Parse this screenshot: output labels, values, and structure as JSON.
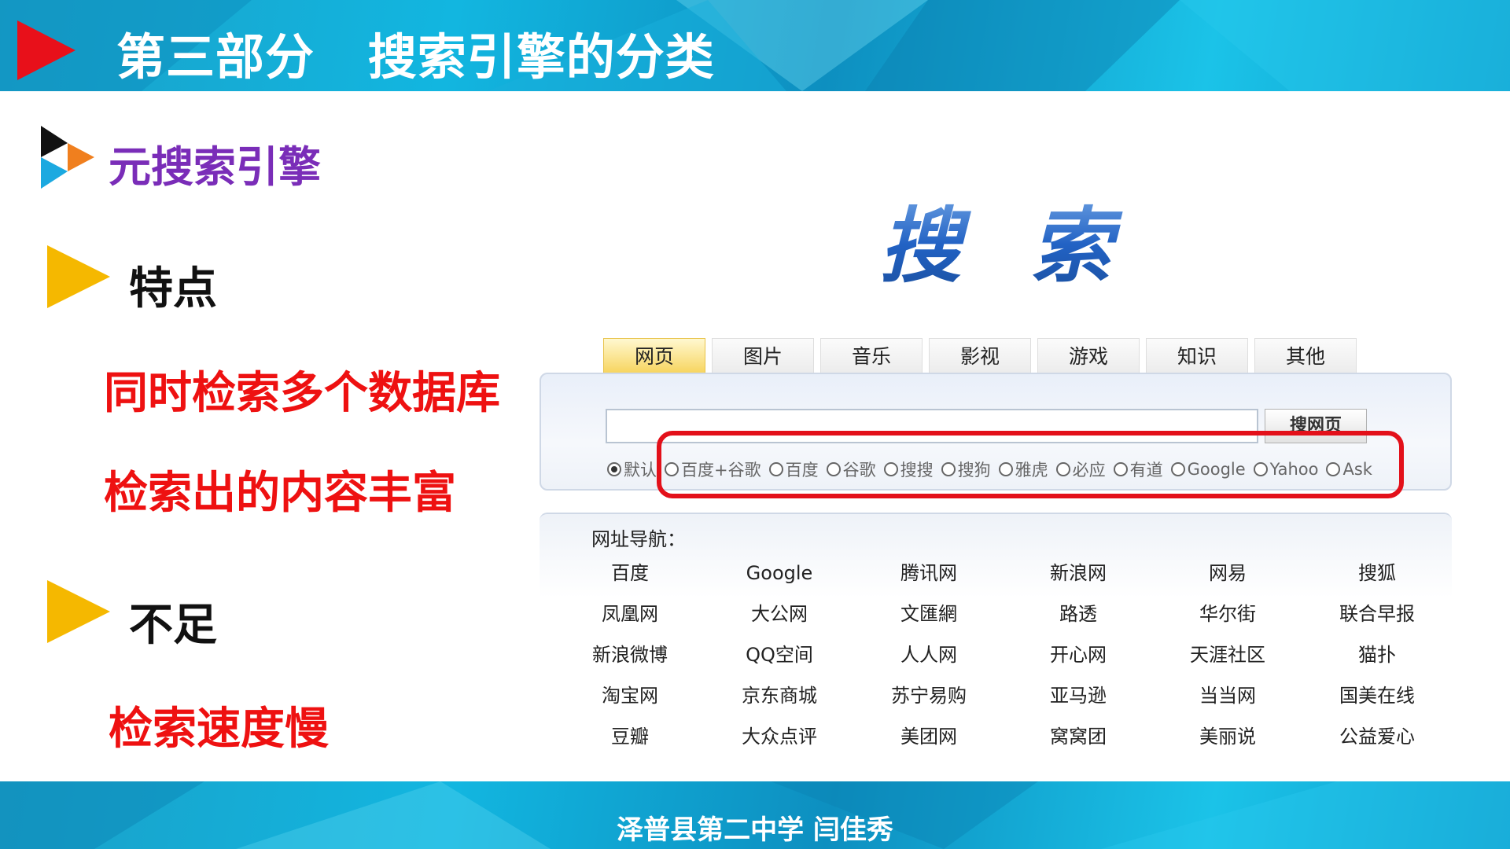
{
  "slide": {
    "title": "第三部分   搜索引擎的分类",
    "footer": "泽普县第二中学  闫佳秀"
  },
  "content": {
    "section_heading": "元搜索引擎",
    "features": {
      "heading": "特点",
      "points": [
        "同时检索多个数据库",
        "检索出的内容丰富"
      ]
    },
    "shortcomings": {
      "heading": "不足",
      "points": [
        "检索速度慢"
      ]
    }
  },
  "search_ui": {
    "logo_text": "搜索",
    "tabs": [
      "网页",
      "图片",
      "音乐",
      "影视",
      "游戏",
      "知识",
      "其他"
    ],
    "active_tab": "网页",
    "search_input_value": "",
    "search_button_label": "搜网页",
    "engines": [
      {
        "label": "默认",
        "checked": true
      },
      {
        "label": "百度+谷歌",
        "checked": false
      },
      {
        "label": "百度",
        "checked": false
      },
      {
        "label": "谷歌",
        "checked": false
      },
      {
        "label": "搜搜",
        "checked": false
      },
      {
        "label": "搜狗",
        "checked": false
      },
      {
        "label": "雅虎",
        "checked": false
      },
      {
        "label": "必应",
        "checked": false
      },
      {
        "label": "有道",
        "checked": false
      },
      {
        "label": "Google",
        "checked": false
      },
      {
        "label": "Yahoo",
        "checked": false
      },
      {
        "label": "Ask",
        "checked": false
      }
    ],
    "highlight_color": "#e3101a",
    "nav_label": "网址导航：",
    "nav_links": [
      "百度",
      "Google",
      "腾讯网",
      "新浪网",
      "网易",
      "搜狐",
      "凤凰网",
      "大公网",
      "文匯網",
      "路透",
      "华尔街",
      "联合早报",
      "新浪微博",
      "QQ空间",
      "人人网",
      "开心网",
      "天涯社区",
      "猫扑",
      "淘宝网",
      "京东商城",
      "苏宁易购",
      "亚马逊",
      "当当网",
      "国美在线",
      "豆瓣",
      "大众点评",
      "美团网",
      "窝窝团",
      "美丽说",
      "公益爱心"
    ]
  },
  "colors": {
    "title_arrow": "#e8101a",
    "section_heading": "#7a2db8",
    "bullet_arrow": "#f5b800",
    "point_text": "#ee1111",
    "band": "#12b6e0"
  }
}
